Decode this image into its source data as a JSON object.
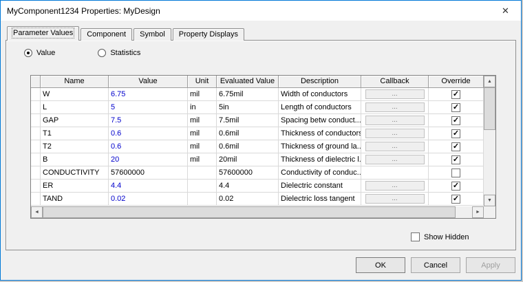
{
  "window": {
    "title": "MyComponent1234 Properties: MyDesign",
    "close_glyph": "✕"
  },
  "tabs": [
    {
      "label": "Parameter Values",
      "active": true
    },
    {
      "label": "Component",
      "active": false
    },
    {
      "label": "Symbol",
      "active": false
    },
    {
      "label": "Property Displays",
      "active": false
    }
  ],
  "options": {
    "value_label": "Value",
    "statistics_label": "Statistics",
    "selected": "Value"
  },
  "table": {
    "headers": [
      "Name",
      "Value",
      "Unit",
      "Evaluated Value",
      "Description",
      "Callback",
      "Override"
    ],
    "rows": [
      {
        "name": "W",
        "value": "6.75",
        "value_color": "#0000cc",
        "unit": "mil",
        "evaluated": "6.75mil",
        "description": "Width of conductors",
        "callback": "...",
        "override": true
      },
      {
        "name": "L",
        "value": "5",
        "value_color": "#0000cc",
        "unit": "in",
        "evaluated": "5in",
        "description": "Length of conductors",
        "callback": "...",
        "override": true
      },
      {
        "name": "GAP",
        "value": "7.5",
        "value_color": "#0000cc",
        "unit": "mil",
        "evaluated": "7.5mil",
        "description": "Spacing betw conduct...",
        "callback": "...",
        "override": true
      },
      {
        "name": "T1",
        "value": "0.6",
        "value_color": "#0000cc",
        "unit": "mil",
        "evaluated": "0.6mil",
        "description": "Thickness of conductors",
        "callback": "...",
        "override": true
      },
      {
        "name": "T2",
        "value": "0.6",
        "value_color": "#0000cc",
        "unit": "mil",
        "evaluated": "0.6mil",
        "description": "Thickness of ground la...",
        "callback": "...",
        "override": true
      },
      {
        "name": "B",
        "value": "20",
        "value_color": "#0000cc",
        "unit": "mil",
        "evaluated": "20mil",
        "description": "Thickness of dielectric l...",
        "callback": "...",
        "override": true
      },
      {
        "name": "CONDUCTIVITY",
        "value": "57600000",
        "value_color": "#000000",
        "unit": "",
        "evaluated": "57600000",
        "description": "Conductivity of conduc...",
        "callback": "",
        "override": false
      },
      {
        "name": "ER",
        "value": "4.4",
        "value_color": "#0000cc",
        "unit": "",
        "evaluated": "4.4",
        "description": "Dielectric constant",
        "callback": "...",
        "override": true
      },
      {
        "name": "TAND",
        "value": "0.02",
        "value_color": "#0000cc",
        "unit": "",
        "evaluated": "0.02",
        "description": "Dielectric loss tangent",
        "callback": "...",
        "override": true
      }
    ]
  },
  "icons": {
    "up": "▲",
    "down": "▼",
    "left": "◄",
    "right": "►"
  },
  "show_hidden": {
    "label": "Show Hidden",
    "checked": false
  },
  "buttons": {
    "ok": "OK",
    "cancel": "Cancel",
    "apply": "Apply",
    "apply_enabled": false
  },
  "colors": {
    "accent_border": "#0078d7",
    "value_text": "#0000cc"
  }
}
